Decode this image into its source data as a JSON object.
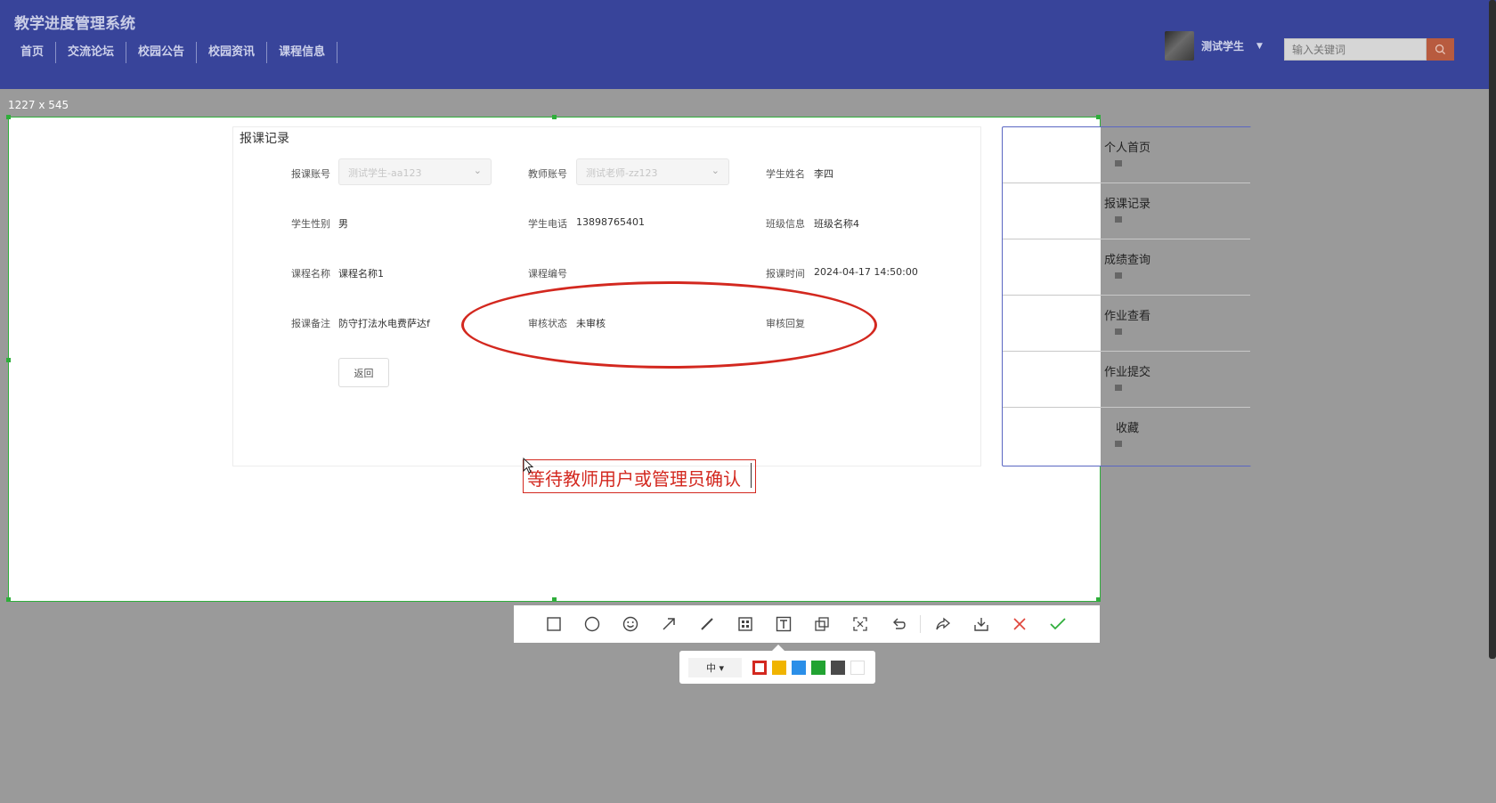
{
  "header": {
    "site_title": "教学进度管理系统",
    "nav": [
      "首页",
      "交流论坛",
      "校园公告",
      "校园资讯",
      "课程信息"
    ],
    "user_name": "测试学生",
    "search_placeholder": "输入关键词"
  },
  "screenshot_tool": {
    "dimension_label": "1227 x 545",
    "annotation_text": "等待教师用户或管理员确认",
    "size_option": "中 ▾",
    "colors": [
      "#d3281f",
      "#f0b400",
      "#2b8fe8",
      "#22a332",
      "#4a4a4a",
      "#ffffff"
    ]
  },
  "form": {
    "title": "报课记录",
    "fields": {
      "account_label": "报课账号",
      "account_value": "测试学生-aa123",
      "teacher_label": "教师账号",
      "teacher_value": "测试老师-zz123",
      "student_name_label": "学生姓名",
      "student_name_value": "李四",
      "gender_label": "学生性别",
      "gender_value": "男",
      "phone_label": "学生电话",
      "phone_value": "13898765401",
      "class_label": "班级信息",
      "class_value": "班级名称4",
      "course_name_label": "课程名称",
      "course_name_value": "课程名称1",
      "course_code_label": "课程编号",
      "course_code_value": "",
      "time_label": "报课时间",
      "time_value": "2024-04-17 14:50:00",
      "remark_label": "报课备注",
      "remark_value": "防守打法水电费萨达f",
      "status_label": "审核状态",
      "status_value": "未审核",
      "reply_label": "审核回复",
      "reply_value": ""
    },
    "back_label": "返回"
  },
  "side_menu": [
    "个人首页",
    "报课记录",
    "成绩查询",
    "作业查看",
    "作业提交",
    "收藏"
  ]
}
